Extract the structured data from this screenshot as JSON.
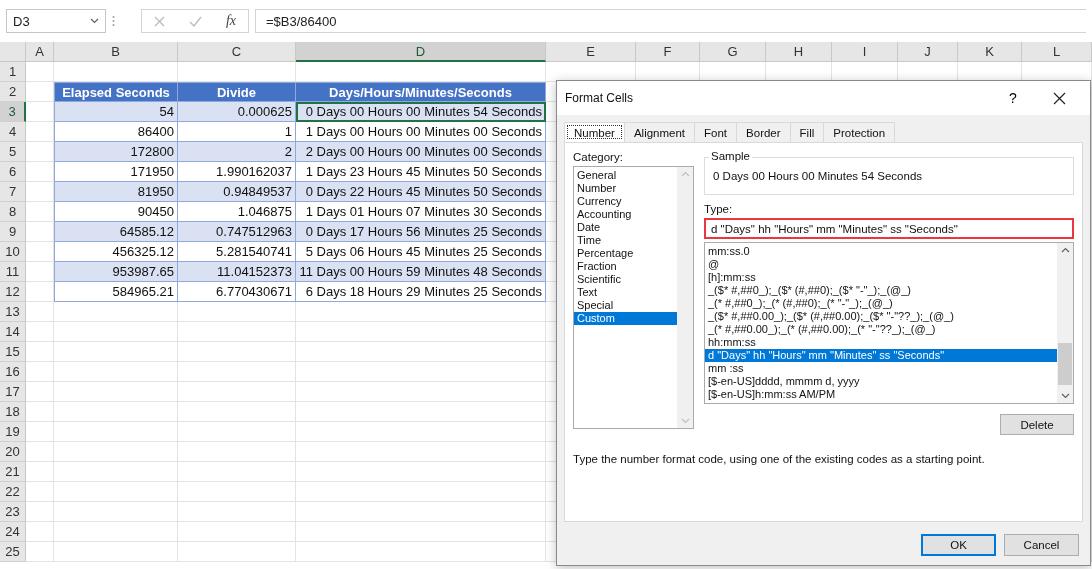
{
  "formula_bar": {
    "name_box": "D3",
    "function_label": "fx",
    "formula": "=$B3/86400"
  },
  "columns": [
    {
      "label": "A",
      "selected": false
    },
    {
      "label": "B",
      "selected": false
    },
    {
      "label": "C",
      "selected": false
    },
    {
      "label": "D",
      "selected": true
    },
    {
      "label": "E",
      "selected": false
    },
    {
      "label": "F",
      "selected": false
    },
    {
      "label": "G",
      "selected": false
    },
    {
      "label": "H",
      "selected": false
    },
    {
      "label": "I",
      "selected": false
    },
    {
      "label": "J",
      "selected": false
    },
    {
      "label": "K",
      "selected": false
    },
    {
      "label": "L",
      "selected": false
    }
  ],
  "rows": [
    {
      "label": "1",
      "selected": false
    },
    {
      "label": "2",
      "selected": false
    },
    {
      "label": "3",
      "selected": true
    },
    {
      "label": "4",
      "selected": false
    },
    {
      "label": "5",
      "selected": false
    },
    {
      "label": "6",
      "selected": false
    },
    {
      "label": "7",
      "selected": false
    },
    {
      "label": "8",
      "selected": false
    },
    {
      "label": "9",
      "selected": false
    },
    {
      "label": "10",
      "selected": false
    },
    {
      "label": "11",
      "selected": false
    },
    {
      "label": "12",
      "selected": false
    },
    {
      "label": "13",
      "selected": false
    },
    {
      "label": "14",
      "selected": false
    },
    {
      "label": "15",
      "selected": false
    },
    {
      "label": "16",
      "selected": false
    },
    {
      "label": "17",
      "selected": false
    },
    {
      "label": "18",
      "selected": false
    },
    {
      "label": "19",
      "selected": false
    },
    {
      "label": "20",
      "selected": false
    },
    {
      "label": "21",
      "selected": false
    },
    {
      "label": "22",
      "selected": false
    },
    {
      "label": "23",
      "selected": false
    },
    {
      "label": "24",
      "selected": false
    },
    {
      "label": "25",
      "selected": false
    }
  ],
  "table": {
    "columns": [
      "Elapsed Seconds",
      "Divide",
      "Days/Hours/Minutes/Seconds"
    ],
    "rows": [
      {
        "cells": [
          "54",
          "0.000625",
          "0 Days 00 Hours 00 Minutes 54 Seconds"
        ],
        "selected": true
      },
      {
        "cells": [
          "86400",
          "1",
          "1 Days 00 Hours 00 Minutes 00 Seconds"
        ],
        "selected": false
      },
      {
        "cells": [
          "172800",
          "2",
          "2 Days 00 Hours 00 Minutes 00 Seconds"
        ],
        "selected": false
      },
      {
        "cells": [
          "171950",
          "1.990162037",
          "1 Days 23 Hours 45 Minutes 50 Seconds"
        ],
        "selected": false
      },
      {
        "cells": [
          "81950",
          "0.94849537",
          "0 Days 22 Hours 45 Minutes 50 Seconds"
        ],
        "selected": false
      },
      {
        "cells": [
          "90450",
          "1.046875",
          "1 Days 01 Hours 07 Minutes 30 Seconds"
        ],
        "selected": false
      },
      {
        "cells": [
          "64585.12",
          "0.747512963",
          "0 Days 17 Hours 56 Minutes 25 Seconds"
        ],
        "selected": false
      },
      {
        "cells": [
          "456325.12",
          "5.281540741",
          "5 Days 06 Hours 45 Minutes 25 Seconds"
        ],
        "selected": false
      },
      {
        "cells": [
          "953987.65",
          "11.04152373",
          "11 Days 00 Hours 59 Minutes 48 Seconds"
        ],
        "selected": false
      },
      {
        "cells": [
          "584965.21",
          "6.770430671",
          "6 Days 18 Hours 29 Minutes 25 Seconds"
        ],
        "selected": false
      }
    ]
  },
  "dialog": {
    "title": "Format Cells",
    "help": "?",
    "tabs": [
      {
        "label": "Number",
        "selected": true
      },
      {
        "label": "Alignment",
        "selected": false
      },
      {
        "label": "Font",
        "selected": false
      },
      {
        "label": "Border",
        "selected": false
      },
      {
        "label": "Fill",
        "selected": false
      },
      {
        "label": "Protection",
        "selected": false
      }
    ],
    "category_label": "Category:",
    "categories": [
      {
        "label": "General",
        "selected": false
      },
      {
        "label": "Number",
        "selected": false
      },
      {
        "label": "Currency",
        "selected": false
      },
      {
        "label": "Accounting",
        "selected": false
      },
      {
        "label": "Date",
        "selected": false
      },
      {
        "label": "Time",
        "selected": false
      },
      {
        "label": "Percentage",
        "selected": false
      },
      {
        "label": "Fraction",
        "selected": false
      },
      {
        "label": "Scientific",
        "selected": false
      },
      {
        "label": "Text",
        "selected": false
      },
      {
        "label": "Special",
        "selected": false
      },
      {
        "label": "Custom",
        "selected": true
      }
    ],
    "sample_label": "Sample",
    "sample_value": "0 Days 00 Hours 00 Minutes 54 Seconds",
    "type_label": "Type:",
    "type_value": "d \"Days\" hh \"Hours\" mm \"Minutes\" ss \"Seconds\"",
    "type_highlighted": true,
    "formats": [
      {
        "label": "mm:ss.0",
        "selected": false
      },
      {
        "label": "@",
        "selected": false
      },
      {
        "label": "[h]:mm:ss",
        "selected": false
      },
      {
        "label": "_($* #,##0_);_($* (#,##0);_($* \"-\"_);_(@_)",
        "selected": false
      },
      {
        "label": "_(* #,##0_);_(* (#,##0);_(* \"-\"_);_(@_)",
        "selected": false
      },
      {
        "label": "_($* #,##0.00_);_($* (#,##0.00);_($* \"-\"??_);_(@_)",
        "selected": false
      },
      {
        "label": "_(* #,##0.00_);_(* (#,##0.00);_(* \"-\"??_);_(@_)",
        "selected": false
      },
      {
        "label": "hh:mm:ss",
        "selected": false
      },
      {
        "label": "d \"Days\" hh \"Hours\" mm \"Minutes\" ss \"Seconds\"",
        "selected": true
      },
      {
        "label": "mm :ss",
        "selected": false
      },
      {
        "label": "[$-en-US]dddd, mmmm d, yyyy",
        "selected": false
      },
      {
        "label": "[$-en-US]h:mm:ss AM/PM",
        "selected": false
      }
    ],
    "delete_button": "Delete",
    "description": "Type the number format code, using one of the existing codes as a starting point.",
    "buttons": [
      {
        "label": "OK",
        "kind": "primary"
      },
      {
        "label": "Cancel",
        "kind": "normal"
      }
    ]
  }
}
